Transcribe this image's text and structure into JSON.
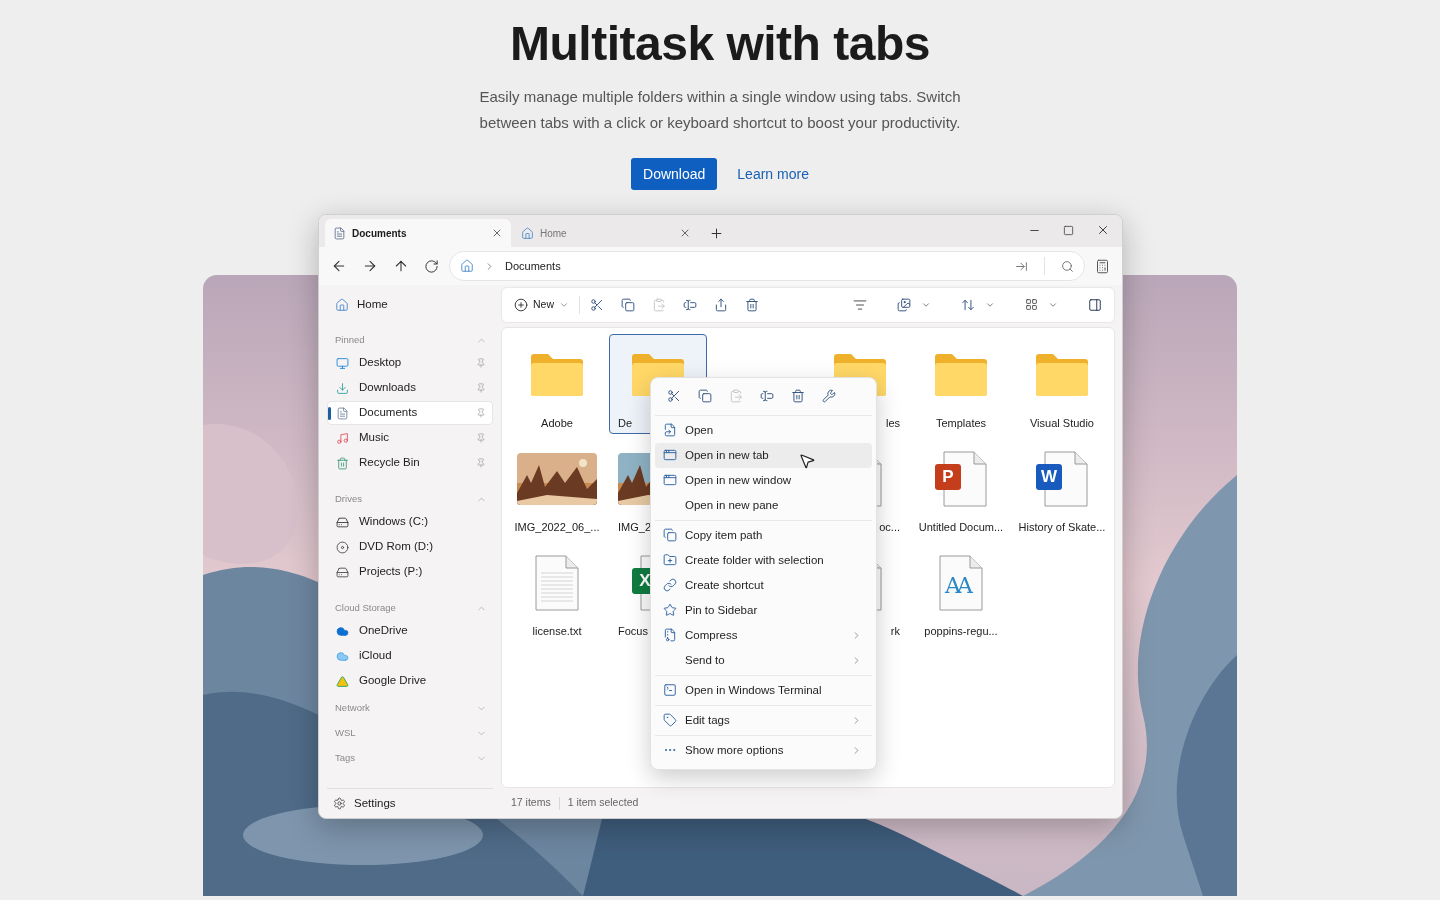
{
  "hero": {
    "title": "Multitask with tabs",
    "subtitle": "Easily manage multiple folders within a single window using tabs. Switch between tabs with a click or keyboard shortcut to boost your productivity.",
    "buttons": [
      {
        "label": "Download",
        "kind": "primary"
      },
      {
        "label": "Learn more",
        "kind": "link"
      }
    ]
  },
  "window": {
    "tabs": [
      {
        "label": "Documents",
        "selected": true
      },
      {
        "label": "Home",
        "selected": false
      }
    ],
    "breadcrumb": [
      "Documents"
    ]
  },
  "sidebar": {
    "home": "Home",
    "sections": [
      {
        "title": "Pinned",
        "expanded": true,
        "items": [
          {
            "label": "Desktop",
            "selected": false,
            "pinned": true
          },
          {
            "label": "Downloads",
            "selected": false,
            "pinned": true
          },
          {
            "label": "Documents",
            "selected": true,
            "pinned": true
          },
          {
            "label": "Music",
            "selected": false,
            "pinned": true
          },
          {
            "label": "Recycle Bin",
            "selected": false,
            "pinned": true
          }
        ]
      },
      {
        "title": "Drives",
        "expanded": true,
        "items": [
          {
            "label": "Windows (C:)",
            "selected": false,
            "pinned": false
          },
          {
            "label": "DVD Rom (D:)",
            "selected": false,
            "pinned": false
          },
          {
            "label": "Projects (P:)",
            "selected": false,
            "pinned": false
          }
        ]
      },
      {
        "title": "Cloud Storage",
        "expanded": true,
        "items": [
          {
            "label": "OneDrive",
            "selected": false,
            "pinned": false
          },
          {
            "label": "iCloud",
            "selected": false,
            "pinned": false
          },
          {
            "label": "Google Drive",
            "selected": false,
            "pinned": false
          }
        ]
      },
      {
        "title": "Network",
        "expanded": false
      },
      {
        "title": "WSL",
        "expanded": false
      },
      {
        "title": "Tags",
        "expanded": false
      }
    ],
    "settings": "Settings"
  },
  "toolbar": {
    "new_label": "New",
    "actions": [
      {
        "disabled": false
      },
      {
        "disabled": false
      },
      {
        "disabled": true
      },
      {
        "disabled": false
      },
      {
        "disabled": false
      },
      {
        "disabled": false
      }
    ]
  },
  "files": {
    "rows": [
      {
        "left": [
          {
            "kind": "folder",
            "label": "Adobe",
            "selected": false
          },
          {
            "kind": "folder",
            "label": "De",
            "selected": true
          }
        ],
        "right": [
          {
            "kind": "folder",
            "label": "les",
            "selected": false
          },
          {
            "kind": "folder",
            "label": "Templates",
            "selected": false
          },
          {
            "kind": "folder",
            "label": "Visual Studio",
            "selected": false
          }
        ]
      },
      {
        "left": [
          {
            "label": "IMG_2022_06_...",
            "selected": false
          },
          {
            "label": "IMG_2",
            "selected": false
          }
        ],
        "right": [
          {
            "kind": "document",
            "label": "oc...",
            "selected": false
          },
          {
            "kind": "app",
            "badge": "P",
            "color": "#c43e1c",
            "label": "Untitled Docum...",
            "selected": false
          },
          {
            "kind": "app",
            "badge": "W",
            "color": "#185abd",
            "label": "History of Skate...",
            "selected": false
          }
        ]
      },
      {
        "left": [
          {
            "kind": "document",
            "label": "license.txt",
            "selected": false
          },
          {
            "kind": "app",
            "badge": "X",
            "color": "#107c41",
            "label": "Focus",
            "selected": false
          }
        ],
        "right": [
          {
            "kind": "document",
            "label": "rk",
            "selected": false
          },
          {
            "kind": "font",
            "badge": "AA",
            "label": "poppins-regu...",
            "selected": false
          }
        ]
      }
    ]
  },
  "context_menu": {
    "quick_actions": [
      {
        "disabled": false
      },
      {
        "disabled": false
      },
      {
        "disabled": true
      },
      {
        "disabled": false
      },
      {
        "disabled": false
      },
      {
        "disabled": false
      }
    ],
    "groups": [
      [
        {
          "label": "Open",
          "submenu": false,
          "selected": false
        },
        {
          "label": "Open in new tab",
          "submenu": false,
          "selected": true
        },
        {
          "label": "Open in new window",
          "submenu": false,
          "selected": false
        },
        {
          "label": "Open in new pane",
          "submenu": false,
          "selected": false
        }
      ],
      [
        {
          "label": "Copy item path",
          "submenu": false,
          "selected": false
        },
        {
          "label": "Create folder with selection",
          "submenu": false,
          "selected": false
        },
        {
          "label": "Create shortcut",
          "submenu": false,
          "selected": false
        },
        {
          "label": "Pin to Sidebar",
          "submenu": false,
          "selected": false
        },
        {
          "label": "Compress",
          "submenu": true,
          "selected": false
        },
        {
          "label": "Send to",
          "submenu": true,
          "selected": false
        }
      ],
      [
        {
          "label": "Open in Windows Terminal",
          "submenu": false,
          "selected": false
        }
      ],
      [
        {
          "label": "Edit tags",
          "submenu": true,
          "selected": false
        }
      ],
      [
        {
          "label": "Show more options",
          "submenu": true,
          "selected": false
        }
      ]
    ]
  },
  "status_bar": {
    "item_count": "17 items",
    "selection": "1 item selected"
  }
}
